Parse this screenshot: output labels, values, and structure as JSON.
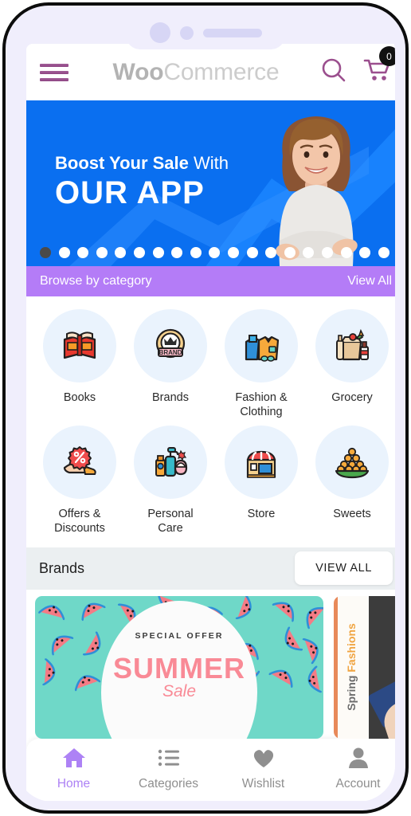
{
  "device": {
    "notch": {
      "camera": "camera-dot",
      "sensor": "sensor-dot",
      "speaker": "speaker-bar"
    }
  },
  "appbar": {
    "menu_icon": "hamburger-menu-icon",
    "brand_bold": "Woo",
    "brand_light": "Commerce",
    "search_icon": "search-icon",
    "cart_icon": "shopping-cart-icon",
    "cart_count": "0"
  },
  "hero": {
    "line1_bold": "Boost Your Sale",
    "line1_light": "With",
    "line2": "OUR APP",
    "dot_count": 20,
    "active_dot": 1,
    "bg_color": "#0a6ff0"
  },
  "categories": {
    "header_title": "Browse by category",
    "view_all": "View All",
    "header_color": "#b47cf7",
    "items": [
      {
        "label": "Books",
        "icon": "open-book-icon"
      },
      {
        "label": "Brands",
        "icon": "brand-badge-icon"
      },
      {
        "label": "Fashion &\nClothing",
        "icon": "clothing-icon"
      },
      {
        "label": "Grocery",
        "icon": "grocery-bag-icon"
      },
      {
        "label": "Offers &\nDiscounts",
        "icon": "discount-hand-icon"
      },
      {
        "label": "Personal\nCare",
        "icon": "personal-care-icon"
      },
      {
        "label": "Store",
        "icon": "storefront-icon"
      },
      {
        "label": "Sweets",
        "icon": "sweets-plate-icon"
      }
    ]
  },
  "brands": {
    "title": "Brands",
    "view_all": "VIEW ALL",
    "cards": [
      {
        "special_offer": "SPECIAL OFFER",
        "headline": "SUMMER",
        "subhead": "Sale",
        "theme": "watermelon"
      },
      {
        "rot_text_plain": "Spring ",
        "rot_text_accent": "Fashions",
        "theme": "spring-fashions"
      }
    ]
  },
  "bottomnav": {
    "items": [
      {
        "label": "Home",
        "icon": "home-icon",
        "active": true
      },
      {
        "label": "Categories",
        "icon": "list-icon",
        "active": false
      },
      {
        "label": "Wishlist",
        "icon": "heart-icon",
        "active": false
      },
      {
        "label": "Account",
        "icon": "user-icon",
        "active": false
      }
    ],
    "active_color": "#ad82f5"
  }
}
